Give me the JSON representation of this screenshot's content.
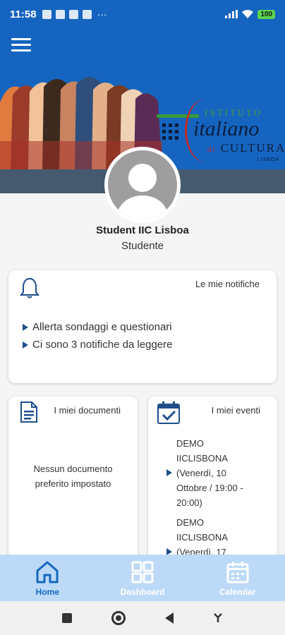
{
  "status": {
    "time": "11:58",
    "battery": "100"
  },
  "user": {
    "name": "Student IIC Lisboa",
    "role": "Studente"
  },
  "logo": {
    "line1": "ISTITUTO",
    "line2": "italiano",
    "line3_prefix": "di",
    "line3": "CULTURA",
    "line4": "LISBOA"
  },
  "notifications": {
    "title": "Le mie notifiche",
    "items": [
      "Allerta sondaggi e questionari",
      "Ci sono 3 notifiche da leggere"
    ]
  },
  "documents": {
    "title": "I miei documenti",
    "empty": "Nessun documento preferito impostato"
  },
  "events": {
    "title": "I miei eventi",
    "items": [
      {
        "lines": [
          "DEMO",
          "IICLISBONA",
          "(Venerdì, 10",
          "Ottobre / 19:00 -",
          "20:00)"
        ]
      },
      {
        "lines": [
          "DEMO",
          "IICLISBONA",
          "(Venerdì, 17"
        ]
      }
    ]
  },
  "nav": {
    "home": "Home",
    "dashboard": "Dashboard",
    "calendar": "Calendar"
  },
  "colors": {
    "primary": "#1565c0",
    "nav_bg": "#bcdaf7"
  }
}
